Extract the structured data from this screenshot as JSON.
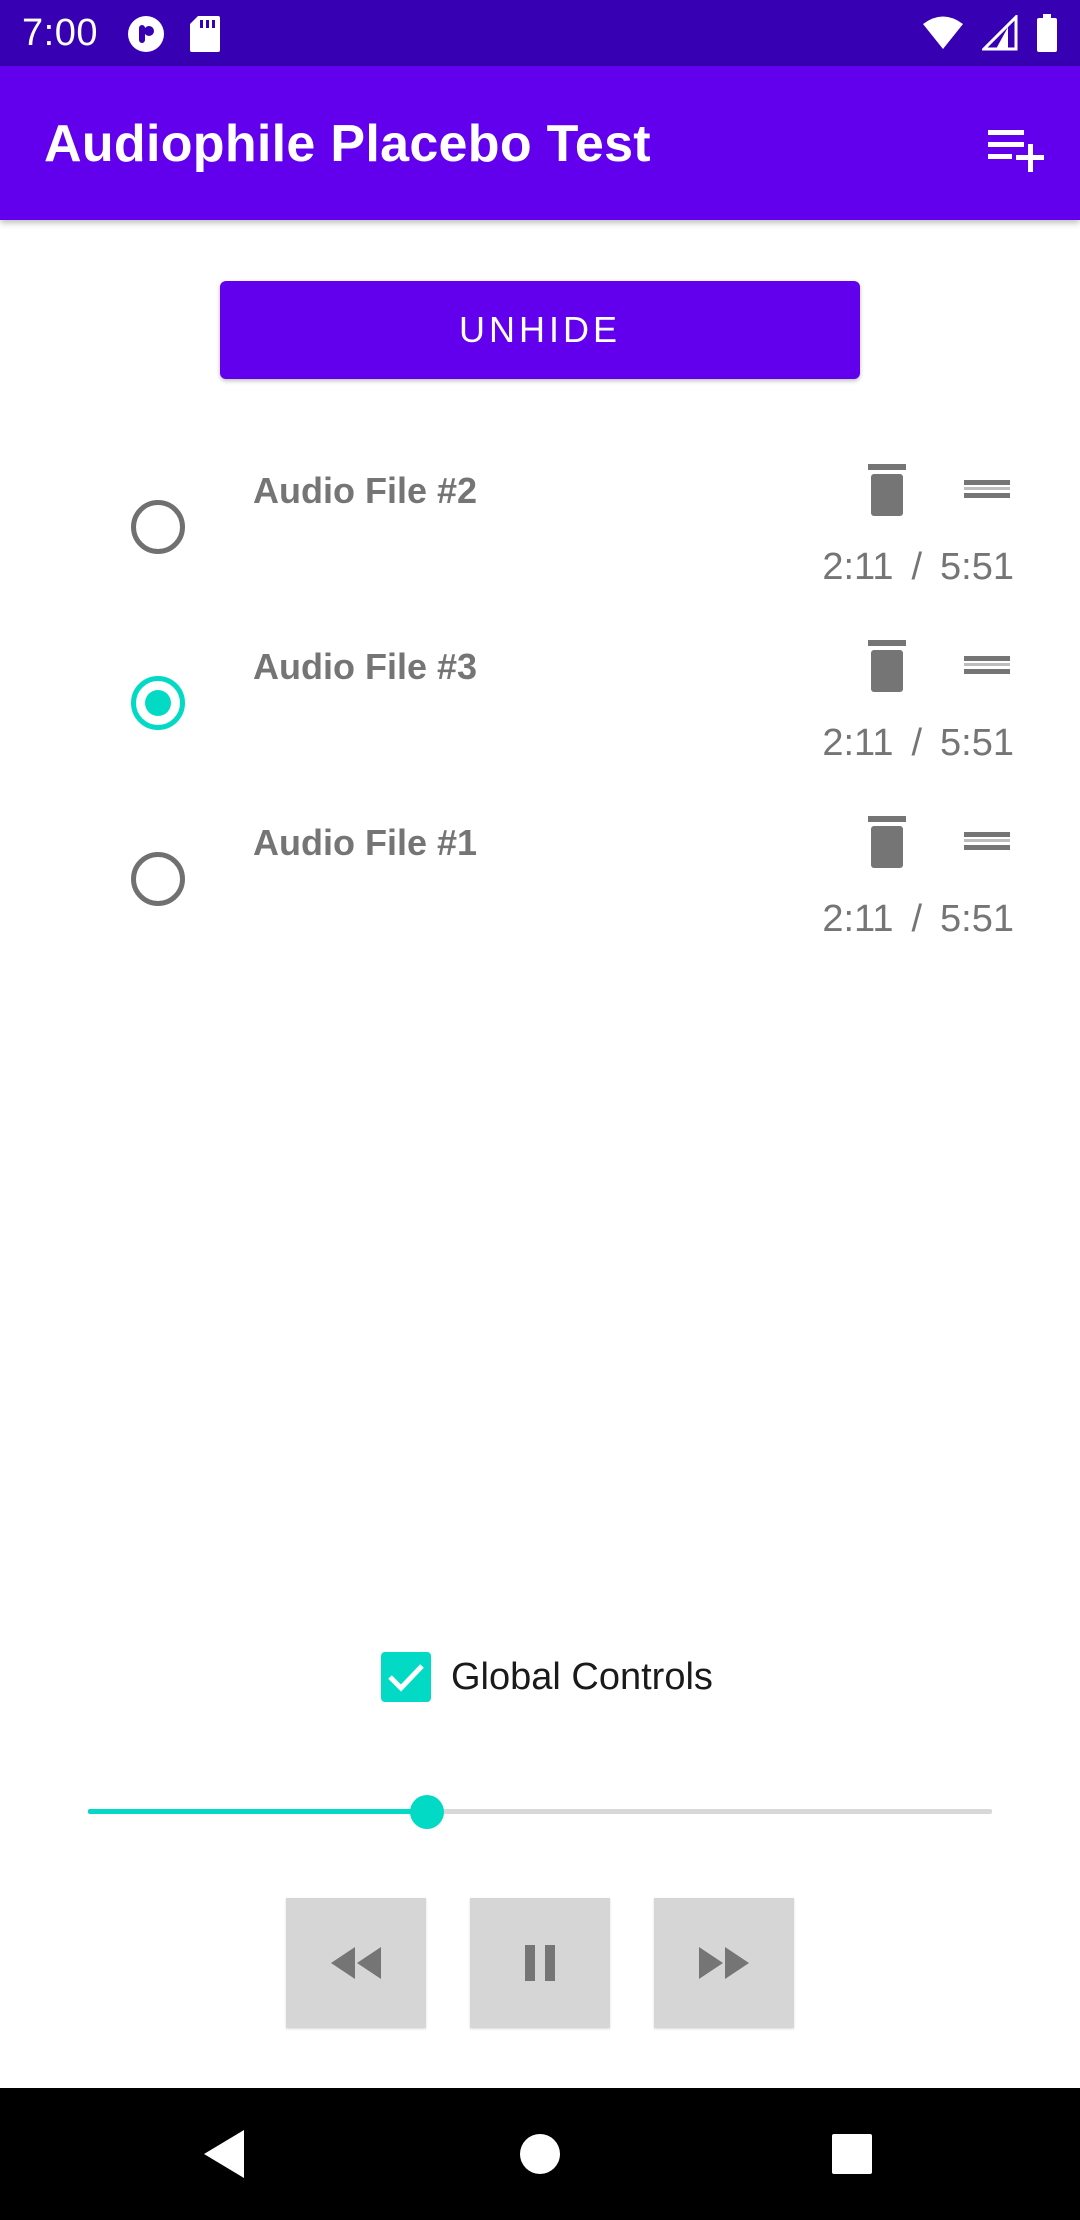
{
  "status_bar": {
    "time": "7:00",
    "left_icons": [
      "pocket-casts-icon",
      "sd-card-icon"
    ],
    "right_icons": [
      "wifi-icon",
      "cell-signal-icon",
      "battery-icon"
    ]
  },
  "app_bar": {
    "title": "Audiophile Placebo Test",
    "action_icon": "playlist-add-icon"
  },
  "unhide_button": {
    "label": "UNHIDE"
  },
  "audio_files": [
    {
      "title": "Audio File #2",
      "position": "2:11",
      "separator": "/",
      "duration": "5:51",
      "selected": false
    },
    {
      "title": "Audio File #3",
      "position": "2:11",
      "separator": "/",
      "duration": "5:51",
      "selected": true
    },
    {
      "title": "Audio File #1",
      "position": "2:11",
      "separator": "/",
      "duration": "5:51",
      "selected": false
    }
  ],
  "global_controls": {
    "label": "Global Controls",
    "checked": true
  },
  "seek_bar": {
    "progress": 0.375
  },
  "playback": {
    "buttons": [
      "rewind-icon",
      "pause-icon",
      "fast-forward-icon"
    ]
  },
  "colors": {
    "status_bar": "#3700b3",
    "primary": "#6200ee",
    "accent": "#03dac5",
    "text_gray": "#757575"
  },
  "nav_bar": {
    "buttons": [
      "back-icon",
      "home-icon",
      "recents-icon"
    ]
  }
}
